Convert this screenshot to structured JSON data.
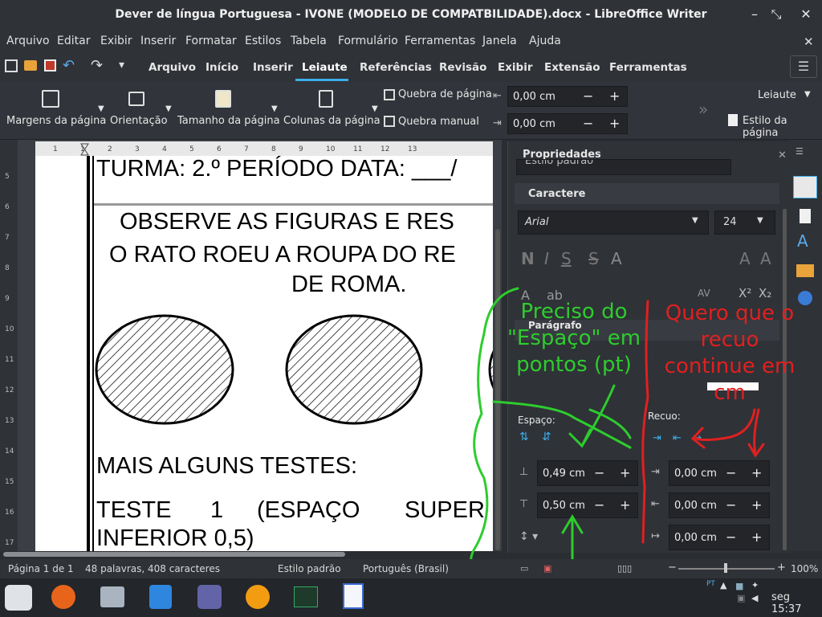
{
  "window": {
    "title": "Dever de língua Portuguesa - IVONE (MODELO DE COMPATBILIDADE).docx - LibreOffice Writer",
    "buttons": [
      "–",
      "⤡",
      "✕"
    ]
  },
  "menu": [
    "Arquivo",
    "Editar",
    "Exibir",
    "Inserir",
    "Formatar",
    "Estilos",
    "Tabela",
    "Formulário",
    "Ferramentas",
    "Janela",
    "Ajuda"
  ],
  "tabs": [
    "Arquivo",
    "Início",
    "Inserir",
    "Leiaute",
    "Referências",
    "Revisão",
    "Exibir",
    "Extensão",
    "Ferramentas"
  ],
  "active_tab": "Leiaute",
  "ribbon": {
    "margins": "Margens da página",
    "orientation": "Orientação",
    "size": "Tamanho da página",
    "columns": "Colunas da página",
    "page_break": "Quebra de página",
    "manual_break": "Quebra manual",
    "indent_left": "0,00 cm",
    "indent_right": "0,00 cm",
    "layout_dropdown": "Leiaute",
    "page_style": "Estilo da página"
  },
  "ruler_labels": [
    "1",
    "1",
    "2",
    "3",
    "4",
    "5",
    "6",
    "7",
    "8",
    "9",
    "10",
    "11",
    "12",
    "13"
  ],
  "vruler_labels": [
    "5",
    "6",
    "7",
    "8",
    "9",
    "10",
    "11",
    "12",
    "13",
    "14",
    "15",
    "16",
    "17"
  ],
  "document": {
    "line1": "TURMA: 2.º PERÍODO DATA: ___/",
    "line2": "OBSERVE AS FIGURAS E RES",
    "line3": "O RATO ROEU A ROUPA DO RE",
    "line4": "DE ROMA.",
    "line5": "MAIS ALGUNS TESTES:",
    "line6a": "TESTE",
    "line6b": "1",
    "line6c": "(ESPAÇO",
    "line6d": "SUPER",
    "line7": "INFERIOR 0,5)"
  },
  "properties": {
    "header": "Propriedades",
    "style_value": "Estilo padrão",
    "character": "Caractere",
    "font_name": "Arial",
    "font_size": "24",
    "paragraph": "Parágrafo",
    "spacing": "Espaço:",
    "indent": "Recuo:",
    "space_above": "0,49 cm",
    "space_below": "0,50 cm",
    "indent_before": "0,00 cm",
    "indent_after": "0,00 cm",
    "indent_first": "0,00 cm"
  },
  "annotations": {
    "green": "Preciso do \"Espaço\" em pontos (pt)",
    "red": "Quero que o recuo continue em cm",
    "green_color": "#2ecc2e",
    "red_color": "#e02020"
  },
  "status": {
    "page": "Página 1 de 1",
    "words": "48 palavras, 408 caracteres",
    "style": "Estilo padrão",
    "lang": "Português (Brasil)",
    "zoom": "100%"
  },
  "taskbar": {
    "clock": "seg 15:37",
    "tray_lang": "PT"
  },
  "colors": {
    "accent": "#3daee9"
  }
}
